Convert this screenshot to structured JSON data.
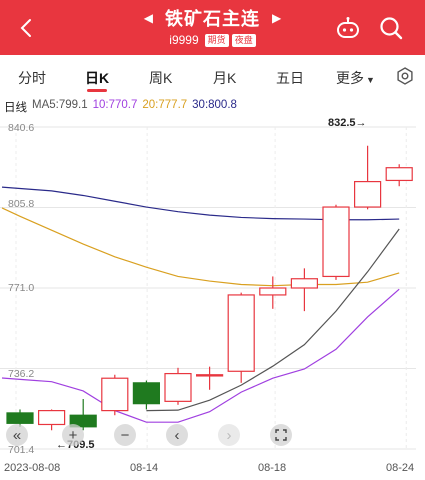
{
  "header": {
    "title": "铁矿石主连",
    "code": "i9999",
    "badges": [
      "期货",
      "夜盘"
    ],
    "bg_color": "#e8363f"
  },
  "tabs": [
    {
      "label": "分时",
      "active": false
    },
    {
      "label": "日K",
      "active": true
    },
    {
      "label": "周K",
      "active": false
    },
    {
      "label": "月K",
      "active": false
    },
    {
      "label": "五日",
      "active": false
    },
    {
      "label": "更多",
      "active": false
    }
  ],
  "ma_bar": {
    "period": "日线",
    "ma5": "MA5:799.1",
    "ma10": "10:770.7",
    "ma20": "20:777.7",
    "ma30": "30:800.8",
    "colors": {
      "ma5": "#555555",
      "ma10": "#a040e0",
      "ma20": "#d9a020",
      "ma30": "#2a2a8a"
    }
  },
  "chart_data": {
    "type": "candlestick",
    "y_ticks": [
      "840.6",
      "805.8",
      "771.0",
      "736.2",
      "701.4"
    ],
    "ylim": [
      701.4,
      840.6
    ],
    "x_ticks": [
      "2023-08-08",
      "08-14",
      "08-18",
      "08-24"
    ],
    "annotations": {
      "high": "832.5→",
      "low": "←709.5"
    },
    "up_color": "#e8363f",
    "down_color": "#1f7a1f",
    "candles": [
      {
        "open": 717.0,
        "close": 712.5,
        "high": 718.5,
        "low": 711.0
      },
      {
        "open": 712.0,
        "close": 718.0,
        "high": 718.5,
        "low": 709.5
      },
      {
        "open": 716.0,
        "close": 711.0,
        "high": 723.0,
        "low": 709.5
      },
      {
        "open": 718.0,
        "close": 732.0,
        "high": 733.5,
        "low": 716.0
      },
      {
        "open": 730.0,
        "close": 721.0,
        "high": 731.0,
        "low": 718.5
      },
      {
        "open": 722.0,
        "close": 734.0,
        "high": 736.5,
        "low": 720.5
      },
      {
        "open": 733.5,
        "close": 733.5,
        "high": 737.0,
        "low": 727.0
      },
      {
        "open": 735.0,
        "close": 768.0,
        "high": 769.0,
        "low": 730.0
      },
      {
        "open": 768.0,
        "close": 771.0,
        "high": 776.0,
        "low": 762.0
      },
      {
        "open": 771.0,
        "close": 775.0,
        "high": 779.5,
        "low": 761.0
      },
      {
        "open": 776.0,
        "close": 806.0,
        "high": 807.0,
        "low": 774.5
      },
      {
        "open": 806.0,
        "close": 817.0,
        "high": 832.5,
        "low": 805.0
      },
      {
        "open": 817.5,
        "close": 823.0,
        "high": 824.5,
        "low": 815.0
      }
    ],
    "ma5": [
      null,
      null,
      null,
      null,
      718.0,
      718.2,
      722.5,
      729.0,
      737.2,
      746.5,
      761.0,
      778.0,
      796.5
    ],
    "ma10": [
      731.5,
      730.5,
      726.5,
      718.0,
      713.0,
      713.0,
      717.5,
      726.0,
      732.0,
      736.0,
      744.5,
      758.5,
      770.5
    ],
    "ma20": [
      802.0,
      796.0,
      790.0,
      784.5,
      780.0,
      776.0,
      774.0,
      772.5,
      772.0,
      772.5,
      772.5,
      773.5,
      777.5
    ],
    "ma30": [
      814.0,
      813.0,
      811.0,
      808.5,
      806.0,
      804.0,
      802.5,
      801.5,
      801.0,
      800.8,
      800.5,
      800.5,
      800.8
    ]
  },
  "zoom_controls": {
    "buttons": [
      "collapse-left",
      "zoom-in",
      "zoom-out",
      "scroll-left",
      "scroll-right",
      "fullscreen"
    ]
  }
}
